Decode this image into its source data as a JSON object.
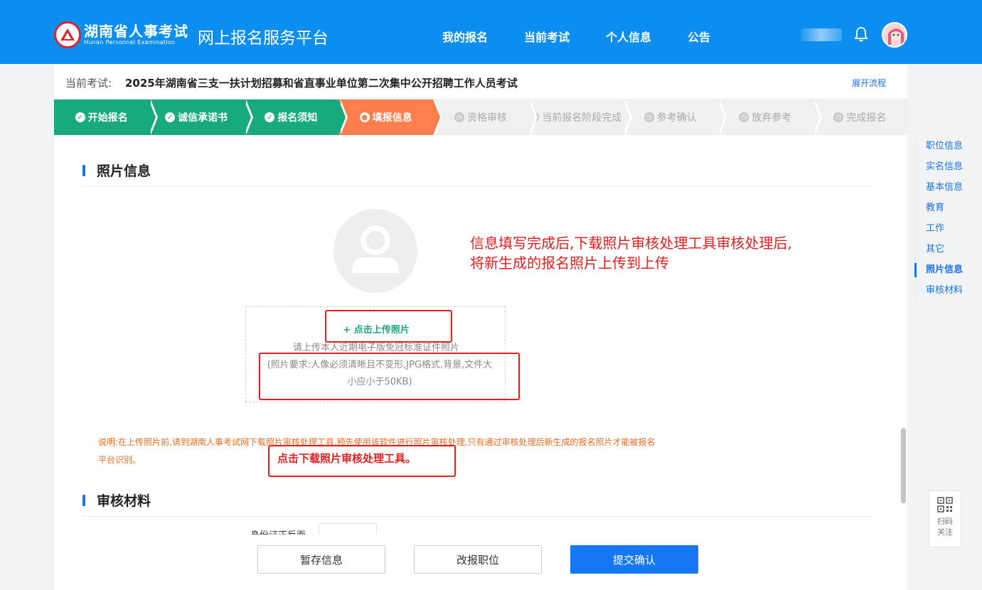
{
  "header": {
    "logo_cn": "湖南省人事考试",
    "logo_en": "Hunan Personnel Examination",
    "platform_name": "网上报名服务平台",
    "nav": [
      "我的报名",
      "当前考试",
      "个人信息",
      "公告"
    ]
  },
  "exam": {
    "label": "当前考试:",
    "title": "2025年湖南省三支一扶计划招募和省直事业单位第二次集中公开招聘工作人员考试",
    "expand_link": "展开流程"
  },
  "steps": [
    {
      "label": "开始报名",
      "state": "done"
    },
    {
      "label": "诚信承诺书",
      "state": "done"
    },
    {
      "label": "报名须知",
      "state": "done"
    },
    {
      "label": "填报信息",
      "state": "active"
    },
    {
      "label": "资格审核",
      "state": "todo"
    },
    {
      "label": "当前报名阶段完成",
      "state": "todo"
    },
    {
      "label": "参考确认",
      "state": "todo"
    },
    {
      "label": "放弃参考",
      "state": "todo"
    },
    {
      "label": "完成报名",
      "state": "todo"
    }
  ],
  "photo_section": {
    "title": "照片信息",
    "upload_button": "+ 点击上传照片",
    "hint": "请上传本人近期电子版免冠标准证件照片",
    "requirements": "(照片要求:人像必须清晰且不变形,JPG格式,背景,文件大小应小于50KB)"
  },
  "annotation": {
    "line1": "信息填写完成后,下载照片审核处理工具审核处理后,",
    "line2": "将新生成的报名照片上传到上传"
  },
  "note": {
    "text": "说明:在上传照片前,请到湖南人事考试网下载照片审核处理工具,预先使用该软件进行照片审核处理,只有通过审核处理后新生成的报名照片才能被报名平台识别。",
    "emphasis": "点击下载照片审核处理工具。"
  },
  "review_section": {
    "title": "审核材料",
    "partial_label": "身份证正反面"
  },
  "actions": {
    "save": "暂存信息",
    "change": "改报职位",
    "submit": "提交确认"
  },
  "sidebar": {
    "items": [
      "职位信息",
      "实名信息",
      "基本信息",
      "教育",
      "工作",
      "其它",
      "照片信息",
      "审核材料"
    ],
    "active_index": 6
  },
  "qr": {
    "line1": "扫码",
    "line2": "关注"
  },
  "colors": {
    "header": "#0b8ef0",
    "step_done": "#18a97e",
    "step_active": "#ff7e4d",
    "primary": "#1677f2",
    "annotation_red": "#e02020",
    "note_orange": "#ef6b24"
  }
}
